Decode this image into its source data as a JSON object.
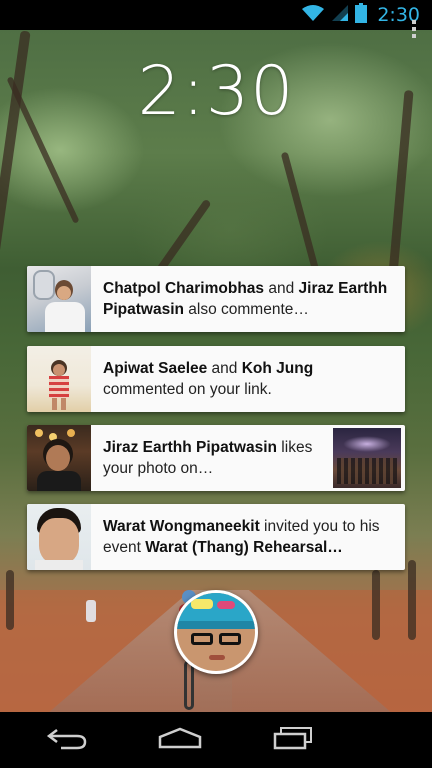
{
  "status_bar": {
    "time": "2:30",
    "icons": [
      "wifi-icon",
      "signal-icon",
      "battery-icon"
    ]
  },
  "lock_screen": {
    "time": "2:30"
  },
  "notifications": [
    {
      "actor1": "Chatpol Charimobhas",
      "joiner": " and ",
      "actor2": "Jiraz Earthh Pipatwasin",
      "rest": " also commente…"
    },
    {
      "actor1": "Apiwat Saelee",
      "joiner": " and ",
      "actor2": "Koh Jung",
      "rest": " commented on your link."
    },
    {
      "actor1": "Jiraz Earthh Pipatwasin",
      "rest": " likes your photo on…"
    },
    {
      "actor1": "Warat Wongmaneekit",
      "middle": " invited you to his event ",
      "event": "Warat (Thang) Rehearsal…"
    }
  ],
  "nav_bar": {
    "buttons": [
      "back-icon",
      "home-icon",
      "recents-icon",
      "menu-icon"
    ]
  },
  "colors": {
    "accent": "#33b5e5",
    "card_bg": "#fafafa",
    "text": "#222222"
  }
}
